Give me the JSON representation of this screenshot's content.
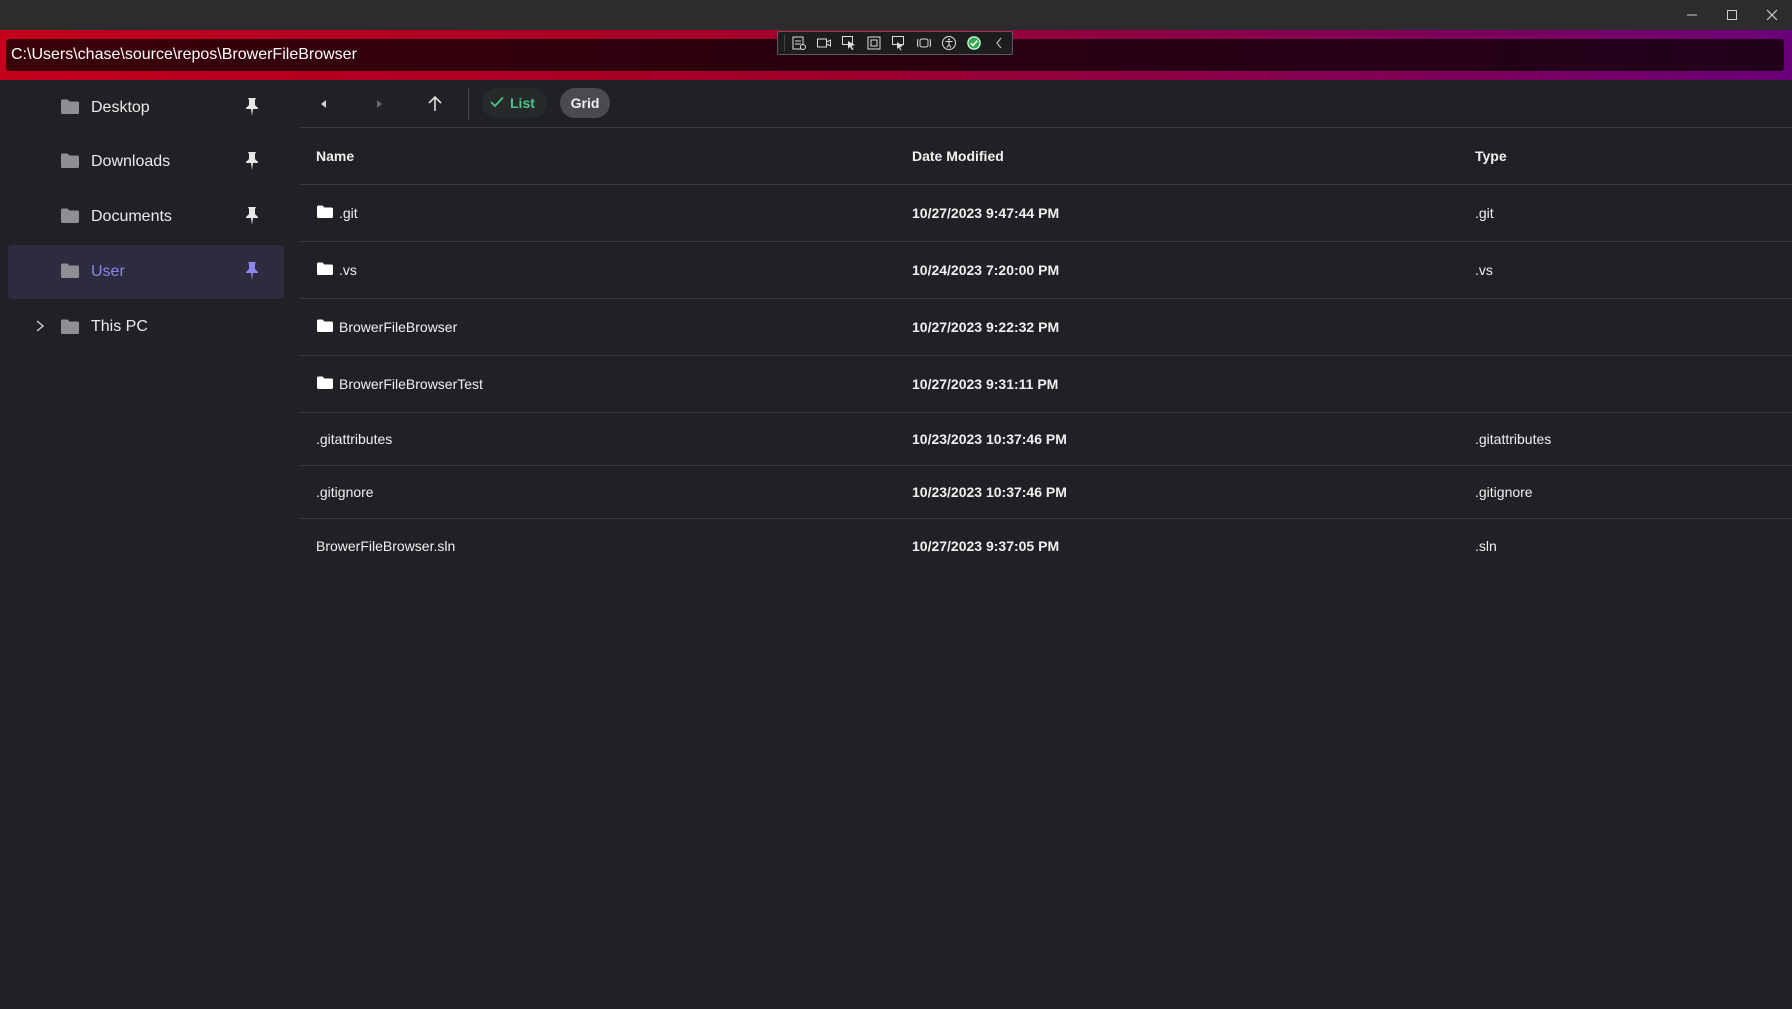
{
  "window": {
    "controls": {
      "minimize": "–",
      "maximize": "☐",
      "close": "✕"
    }
  },
  "address": {
    "path": "C:\\Users\\chase\\source\\repos\\BrowerFileBrowser"
  },
  "sidebar": {
    "items": [
      {
        "label": "Desktop",
        "pinned": true,
        "selected": false
      },
      {
        "label": "Downloads",
        "pinned": true,
        "selected": false
      },
      {
        "label": "Documents",
        "pinned": true,
        "selected": false
      },
      {
        "label": "User",
        "pinned": true,
        "selected": true
      },
      {
        "label": "This PC",
        "expandable": true,
        "selected": false
      }
    ]
  },
  "toolbar": {
    "list_label": "List",
    "grid_label": "Grid",
    "active_view": "List"
  },
  "table": {
    "columns": {
      "name": "Name",
      "date": "Date Modified",
      "type": "Type"
    },
    "rows": [
      {
        "name": ".git",
        "date": "10/27/2023 9:47:44 PM",
        "type": ".git",
        "is_folder": true
      },
      {
        "name": ".vs",
        "date": "10/24/2023 7:20:00 PM",
        "type": ".vs",
        "is_folder": true
      },
      {
        "name": "BrowerFileBrowser",
        "date": "10/27/2023 9:22:32 PM",
        "type": "",
        "is_folder": true
      },
      {
        "name": "BrowerFileBrowserTest",
        "date": "10/27/2023 9:31:11 PM",
        "type": "",
        "is_folder": true
      },
      {
        "name": ".gitattributes",
        "date": "10/23/2023 10:37:46 PM",
        "type": ".gitattributes",
        "is_folder": false
      },
      {
        "name": ".gitignore",
        "date": "10/23/2023 10:37:46 PM",
        "type": ".gitignore",
        "is_folder": false
      },
      {
        "name": "BrowerFileBrowser.sln",
        "date": "10/27/2023 9:37:05 PM",
        "type": ".sln",
        "is_folder": false
      }
    ]
  },
  "colors": {
    "accent_selected": "#8b86e8",
    "list_check": "#4cc38a",
    "band_start": "#c4001c",
    "band_end": "#6a0078"
  }
}
